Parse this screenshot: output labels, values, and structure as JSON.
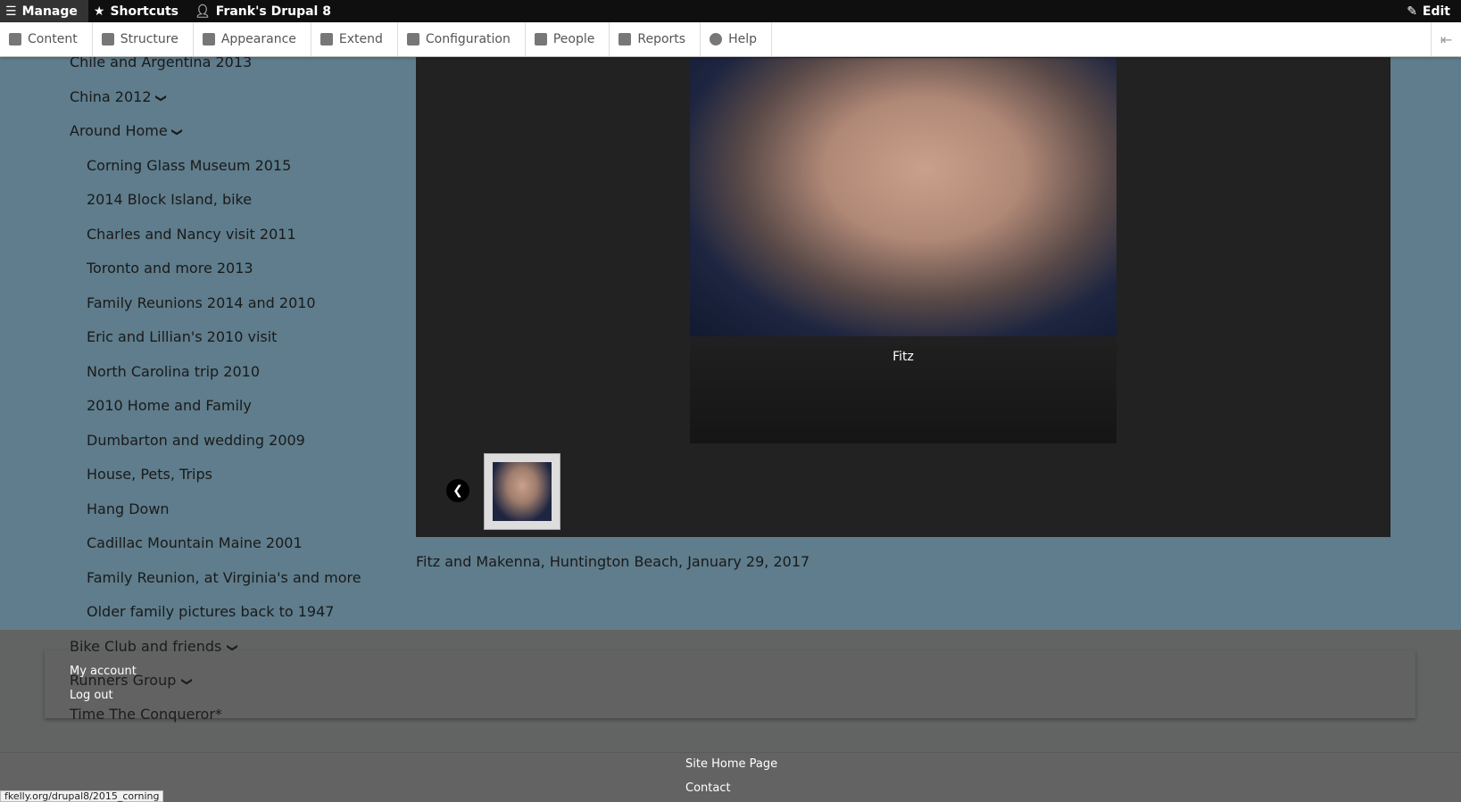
{
  "toolbar": {
    "manage": "Manage",
    "shortcuts": "Shortcuts",
    "site": "Frank's Drupal 8",
    "edit": "Edit"
  },
  "tray": [
    {
      "label": "Content",
      "icon": "file-icon"
    },
    {
      "label": "Structure",
      "icon": "sitemap-icon"
    },
    {
      "label": "Appearance",
      "icon": "paintbrush-icon"
    },
    {
      "label": "Extend",
      "icon": "puzzle-icon"
    },
    {
      "label": "Configuration",
      "icon": "wrench-icon"
    },
    {
      "label": "People",
      "icon": "people-icon"
    },
    {
      "label": "Reports",
      "icon": "bar-chart-icon"
    },
    {
      "label": "Help",
      "icon": "help-icon"
    }
  ],
  "sidebar": {
    "top": [
      {
        "label": "Chile and Argentina 2013"
      },
      {
        "label": "China 2012",
        "expand": true
      },
      {
        "label": "Around Home",
        "expand": true
      }
    ],
    "sub": [
      "Corning Glass Museum 2015",
      "2014 Block Island, bike",
      "Charles and Nancy visit 2011",
      "Toronto and more 2013",
      "Family Reunions 2014 and 2010",
      "Eric and Lillian's 2010 visit",
      "North Carolina trip 2010",
      "2010 Home and Family",
      "Dumbarton and wedding 2009",
      "House, Pets, Trips",
      "Hang Down",
      "Cadillac Mountain Maine 2001",
      "Family Reunion, at Virginia's and more",
      "Older family pictures back to 1947"
    ],
    "bottom": [
      "Bike Club and friends",
      "Runners Group",
      "Time The Conqueror*"
    ]
  },
  "gallery": {
    "caption": "Fitz",
    "description": "Fitz and Makenna, Huntington Beach, January 29, 2017"
  },
  "user_menu": {
    "my_account": "My account",
    "logout": "Log out"
  },
  "footer": {
    "home": "Site Home Page",
    "contact": "Contact"
  },
  "status_url": "fkelly.org/drupal8/2015_corning"
}
